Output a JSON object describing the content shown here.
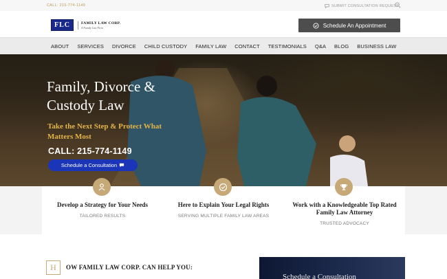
{
  "topbar": {
    "phone": "CALL: 215-774-1149",
    "submit": "SUBMIT CONSULTATION REQUEST"
  },
  "logo": {
    "mark": "FLC",
    "name": "FAMILY LAW CORP.",
    "tagline": "A Family Law Firm"
  },
  "header": {
    "appointment_label": "Schedule An Appointment"
  },
  "nav": {
    "items": [
      "ABOUT",
      "SERVICES",
      "DIVORCE",
      "CHILD CUSTODY",
      "FAMILY LAW",
      "CONTACT",
      "TESTIMONIALS",
      "Q&A",
      "BLOG",
      "BUSINESS LAW"
    ]
  },
  "hero": {
    "title": "Family, Divorce & Custody Law",
    "tagline": "Take the Next Step & Protect What Matters Most",
    "call": "CALL: 215-774-1149",
    "schedule_label": "Schedule a Consultation"
  },
  "cards": [
    {
      "icon": "person-icon",
      "title": "Develop a Strategy for Your Needs",
      "subtitle": "TAILORED RESULTS"
    },
    {
      "icon": "check-circle-icon",
      "title": "Here to Explain Your Legal Rights",
      "subtitle": "SERVING MULTIPLE FAMILY LAW AREAS"
    },
    {
      "icon": "trophy-icon",
      "title": "Work with a Knowledgeable Top Rated Family Law Attorney",
      "subtitle": "TRUSTED ADVOCACY"
    }
  ],
  "lower": {
    "drop_cap": "H",
    "heading": "OW FAMILY LAW CORP. CAN HELP YOU:",
    "panel_text": "Schedule a Consultation"
  },
  "colors": {
    "gold": "#c7a978",
    "accent_blue": "#1a35b8",
    "dark_button": "#4d4d4d"
  }
}
